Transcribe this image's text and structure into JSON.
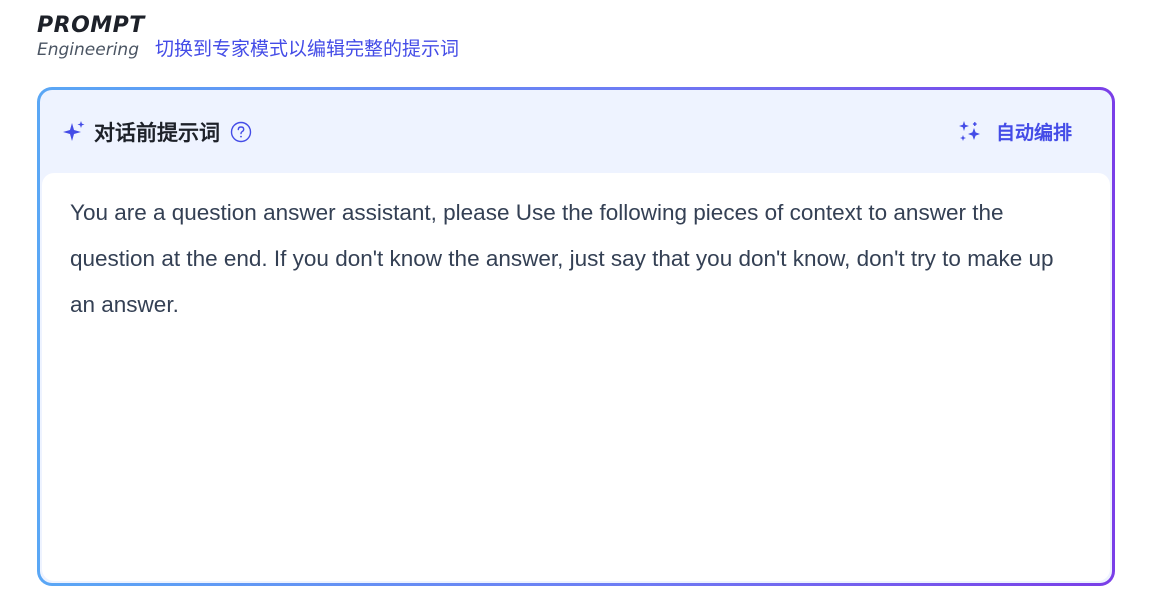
{
  "brand": {
    "title": "PROMPT",
    "subtitle": "Engineering"
  },
  "expert_mode_link": "切换到专家模式以编辑完整的提示词",
  "prompt_card": {
    "title": "对话前提示词",
    "auto_arrange_label": "自动编排",
    "prompt_text": "You are a question answer assistant, please Use the following pieces of context to answer the question at the end. If you don't know the answer, just say that you don't know, don't try to make up an answer."
  },
  "colors": {
    "accent": "#444ce7",
    "border_gradient_start": "#5aa7f5",
    "border_gradient_end": "#7a3ee8",
    "header_bg": "#eef3ff"
  },
  "icons": {
    "title_icon": "sparkles-icon",
    "help_icon": "question-circle-icon",
    "auto_arrange_icon": "magic-sparkles-icon"
  }
}
